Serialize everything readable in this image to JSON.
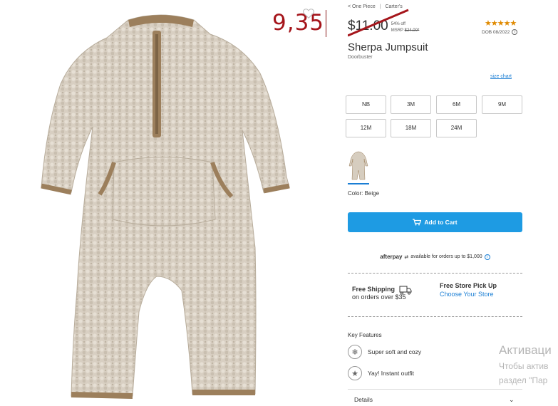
{
  "breadcrumb": {
    "category": "< One Piece",
    "brand": "Carter's"
  },
  "overlay_price": "9,35",
  "price": {
    "current": "$11.00",
    "percent_off": "54% off",
    "msrp_label": "MSRP",
    "msrp_value": "$24.00*"
  },
  "rating": {
    "stars": 5,
    "star_glyphs": "★★★★★"
  },
  "dob": "DOB 08/2022",
  "product": {
    "title": "Sherpa Jumpsuit",
    "subtitle": "Doorbuster"
  },
  "size_chart_label": "size chart",
  "sizes": [
    "NB",
    "3M",
    "6M",
    "9M",
    "12M",
    "18M",
    "24M"
  ],
  "color": {
    "label": "Color: Beige",
    "swatch_hex": "#d6cdbf",
    "trim_hex": "#9c7f5c"
  },
  "add_to_cart_label": "Add to Cart",
  "afterpay": {
    "brand": "afterpay",
    "text": "available for orders up to $1,000"
  },
  "shipping": {
    "free_shipping_title": "Free Shipping",
    "free_shipping_sub": "on orders over $35",
    "pickup_title": "Free Store Pick Up",
    "pickup_link": "Choose Your Store"
  },
  "key_features": {
    "title": "Key Features",
    "items": [
      {
        "icon": "snowflake-icon",
        "label": "Super soft and cozy"
      },
      {
        "icon": "star-badge-icon",
        "label": "Yay! Instant outfit"
      }
    ]
  },
  "details_label": "Details",
  "watermark": {
    "line1": "Активаци",
    "line2": "Чтобы актив",
    "line3": "раздел \"Пар"
  },
  "colors": {
    "accent": "#1e9be3",
    "link": "#1a7ed4",
    "overlay_red": "#a5151b",
    "star": "#e08a00"
  }
}
